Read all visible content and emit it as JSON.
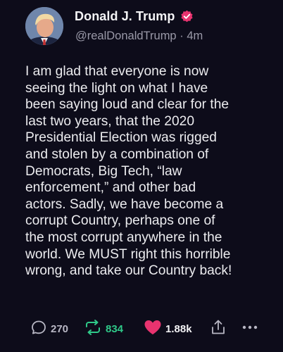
{
  "author": {
    "display_name": "Donald J. Trump",
    "handle": "@realDonaldTrump",
    "separator": "·",
    "time_ago": "4m",
    "verified_badge_color": "#e8336f"
  },
  "post": {
    "lines": [
      "I am glad that everyone is now",
      "seeing the light on what I have",
      "been saying loud and clear for the",
      "last two years, that the 2020",
      "Presidential Election was rigged",
      "and stolen by a combination of",
      "Democrats, Big Tech, “law",
      "enforcement,” and other bad",
      "actors. Sadly, we have become a",
      "corrupt Country, perhaps one of",
      "the most corrupt anywhere in the",
      "world. We MUST right this horrible",
      "wrong, and take our Country back!"
    ]
  },
  "actions": {
    "reply_count": "270",
    "repost_count": "834",
    "like_count": "1.88k",
    "icons": [
      "reply-icon",
      "repost-icon",
      "heart-icon",
      "share-icon",
      "more-icon"
    ],
    "repost_color": "#2fc989",
    "like_color": "#e8336f"
  }
}
